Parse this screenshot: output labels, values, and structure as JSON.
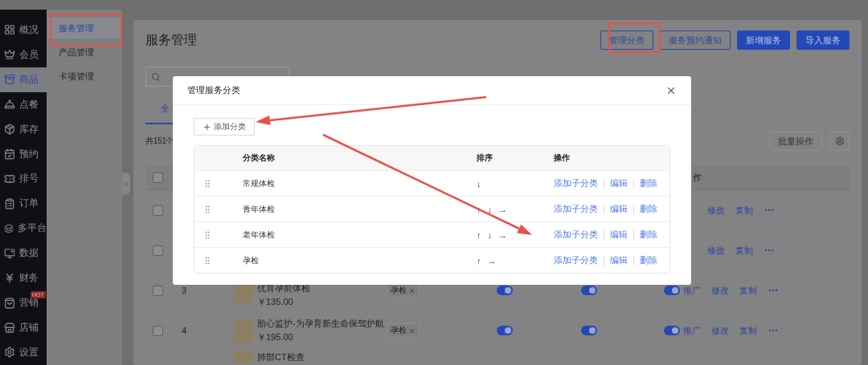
{
  "sidebar": {
    "items": [
      {
        "label": "概况",
        "selected": false
      },
      {
        "label": "会员",
        "selected": false
      },
      {
        "label": "商品",
        "selected": true
      },
      {
        "label": "点餐",
        "selected": false
      },
      {
        "label": "库存",
        "selected": false
      },
      {
        "label": "预约",
        "selected": false
      },
      {
        "label": "排号",
        "selected": false
      },
      {
        "label": "订单",
        "selected": false
      },
      {
        "label": "多平台",
        "selected": false
      },
      {
        "label": "数据",
        "selected": false
      },
      {
        "label": "财务",
        "selected": false
      },
      {
        "label": "营销",
        "selected": false,
        "badge": "HOT"
      },
      {
        "label": "店铺",
        "selected": false
      },
      {
        "label": "设置",
        "selected": false
      }
    ]
  },
  "subnav": {
    "items": [
      {
        "label": "服务管理",
        "selected": true
      },
      {
        "label": "产品管理",
        "selected": false
      },
      {
        "label": "卡项管理",
        "selected": false
      }
    ]
  },
  "page": {
    "title": "服务管理",
    "buttons": [
      {
        "label": "管理分类",
        "kind": "outline"
      },
      {
        "label": "服务预约通知",
        "kind": "outline"
      },
      {
        "label": "新增服务",
        "kind": "primary"
      },
      {
        "label": "导入服务",
        "kind": "primary"
      }
    ],
    "tab": {
      "label": "全",
      "selected": true
    },
    "count": "共151个",
    "batch_button": "批量操作"
  },
  "table": {
    "header": {
      "checked": false,
      "action_heading": "作"
    },
    "rows": [
      {
        "checked": false,
        "actions": [
          "修改",
          "复制"
        ]
      },
      {
        "checked": false,
        "actions": [
          "修改",
          "复制"
        ]
      },
      {
        "checked": false,
        "index": "3",
        "name": "优育孕前体检",
        "price": "￥135.00",
        "tag": "孕检",
        "toggles": [
          {
            "on": true
          },
          {
            "on": true
          },
          {
            "on": true
          }
        ],
        "actions": [
          "推广",
          "修改",
          "复制"
        ]
      },
      {
        "checked": false,
        "index": "4",
        "name": "胎心监护-为孕育新生命保驾护航",
        "price": "￥195.00",
        "tag": "孕检",
        "toggles": [
          {
            "on": true
          },
          {
            "on": true
          },
          {
            "on": true
          }
        ],
        "actions": [
          "推广",
          "修改",
          "复制"
        ]
      },
      {
        "name": "肺部CT检查"
      }
    ]
  },
  "dialog": {
    "title": "管理服务分类",
    "add_button": "添加分类",
    "columns": [
      "分类名称",
      "排序",
      "操作"
    ],
    "rows": [
      {
        "name": "常规体检",
        "sort": [
          "↓"
        ],
        "actions": [
          "添加子分类",
          "编辑",
          "删除"
        ]
      },
      {
        "name": "青年体检",
        "sort": [
          "↑",
          "↓",
          "→"
        ],
        "actions": [
          "添加子分类",
          "编辑",
          "删除"
        ]
      },
      {
        "name": "老年体检",
        "sort": [
          "↑",
          "↓",
          "→"
        ],
        "actions": [
          "添加子分类",
          "编辑",
          "删除"
        ]
      },
      {
        "name": "孕检",
        "sort": [
          "↑",
          "→"
        ],
        "actions": [
          "添加子分类",
          "编辑",
          "删除"
        ]
      }
    ]
  }
}
